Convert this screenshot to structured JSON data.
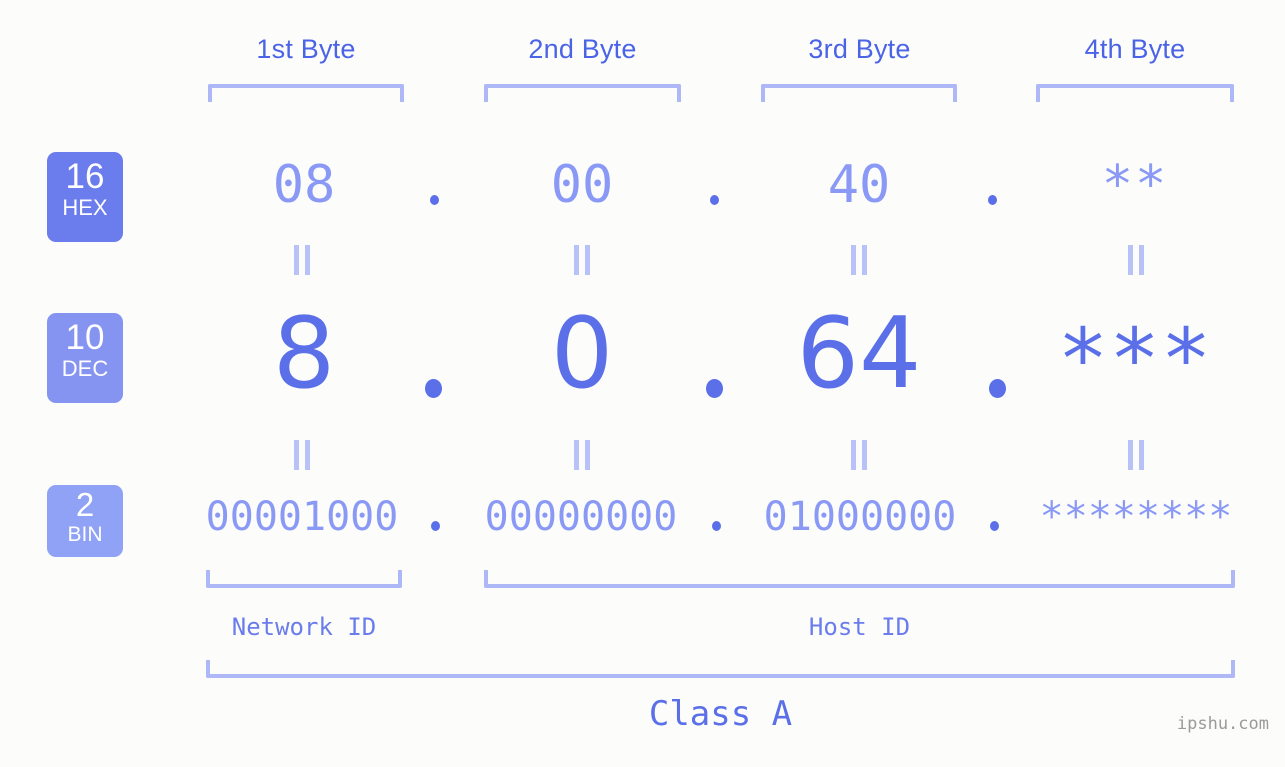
{
  "background_color": "#fcfdfa",
  "accent_color": "#5a6fe8",
  "accent_light_color": "#8a99f5",
  "bracket_color": "#aeb8f7",
  "byte_headers": [
    {
      "label": "1st Byte"
    },
    {
      "label": "2nd Byte"
    },
    {
      "label": "3rd Byte"
    },
    {
      "label": "4th Byte"
    }
  ],
  "rows": {
    "hex": {
      "base_number": "16",
      "base_tag": "HEX",
      "badge_color": "#6b7ced",
      "values": [
        "08",
        "00",
        "40",
        "**"
      ],
      "separator": "."
    },
    "dec": {
      "base_number": "10",
      "base_tag": "DEC",
      "badge_color": "#8694f1",
      "values": [
        "8",
        "0",
        "64",
        "***"
      ],
      "separator": "."
    },
    "bin": {
      "base_number": "2",
      "base_tag": "BIN",
      "badge_color": "#8fa2f5",
      "values": [
        "00001000",
        "00000000",
        "01000000",
        "********"
      ],
      "separator": "."
    }
  },
  "equals_symbol": "=",
  "id_labels": {
    "network": "Network ID",
    "host": "Host ID"
  },
  "class_label": "Class A",
  "watermark": "ipshu.com"
}
